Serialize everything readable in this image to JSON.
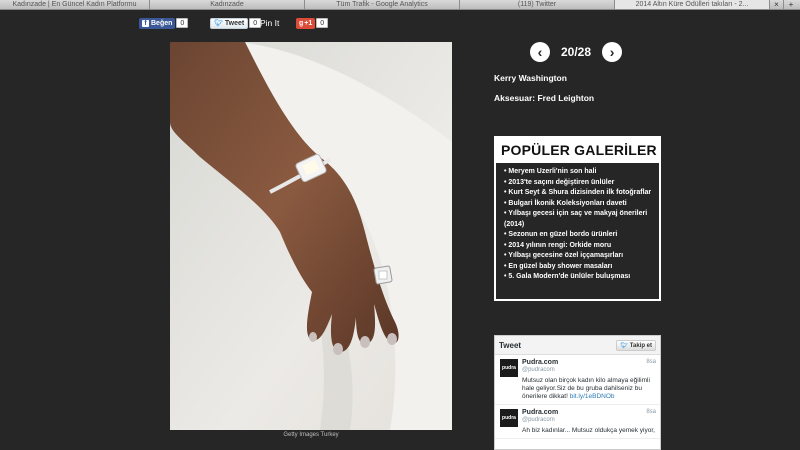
{
  "browser": {
    "tabs": [
      {
        "label": "Kadınzade | En Güncel Kadın Platformu"
      },
      {
        "label": "Kadınzade"
      },
      {
        "label": "Tüm Trafik - Google Analytics"
      },
      {
        "label": "(119) Twitter"
      },
      {
        "label": "2014 Altın Küre Ödülleri takıları - 2..."
      }
    ],
    "close_glyph": "×",
    "plus_glyph": "+"
  },
  "share": {
    "facebook": {
      "label": "Beğen",
      "count": "0",
      "icon": "facebook-icon"
    },
    "twitter": {
      "label": "Tweet",
      "count": "0",
      "icon": "twitter-bird-icon"
    },
    "pinterest": {
      "label": "Pin It"
    },
    "gplus": {
      "label": "+1",
      "count": "0",
      "icon": "google-plus-icon"
    }
  },
  "gallery": {
    "credit": "Getty Images Turkey",
    "counter": "20/28",
    "person": "Kerry Washington",
    "accessory": "Aksesuar: Fred Leighton"
  },
  "popular": {
    "title": "POPÜLER GALERİLER",
    "items": [
      "• Meryem Uzerli'nin son hali",
      "• 2013'te saçını değiştiren ünlüler",
      "• Kurt Seyt & Shura dizisinden ilk fotoğraflar",
      "• Bulgari İkonik Koleksiyonları daveti",
      "• Yılbaşı gecesi için saç ve makyaj önerileri (2014)",
      "• Sezonun en güzel bordo ürünleri",
      "• 2014 yılının rengi: Orkide moru",
      "• Yılbaşı gecesine özel iççamaşırları",
      "• En güzel baby shower masaları",
      "• 5. Gala Modern'de ünlüler buluşması"
    ]
  },
  "twitter_widget": {
    "title": "Tweet",
    "follow_label": "Takip et",
    "tweets": [
      {
        "name": "Pudra.com",
        "handle": "@pudracom",
        "time": "8sa",
        "avatar": "pudra",
        "text": "Mutsuz olan birçok kadın kilo almaya eğilimli hale geliyor.Siz de bu gruba dahilseniz bu önerilere dikkat! ",
        "link": "bit.ly/1eBDNOb"
      },
      {
        "name": "Pudra.com",
        "handle": "@pudracom",
        "time": "8sa",
        "avatar": "pudra",
        "text": "Ah biz kadınlar... Mutsuz oldukça yemek yiyor,",
        "link": ""
      }
    ]
  },
  "colors": {
    "background": "#262626",
    "facebook": "#3b5998",
    "twitter": "#55acee",
    "gplus": "#dd4b39"
  }
}
